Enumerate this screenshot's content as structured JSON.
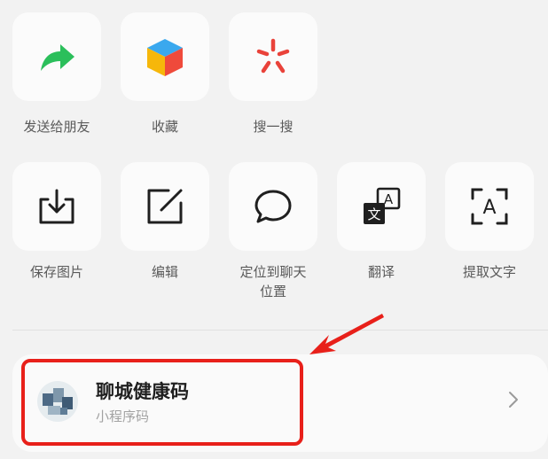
{
  "actions_row1": [
    {
      "label": "发送给朋友",
      "icon": "share-arrow-icon"
    },
    {
      "label": "收藏",
      "icon": "cube-icon"
    },
    {
      "label": "搜一搜",
      "icon": "search-star-icon"
    }
  ],
  "actions_row2": [
    {
      "label": "保存图片",
      "icon": "download-icon"
    },
    {
      "label": "编辑",
      "icon": "edit-icon"
    },
    {
      "label": "定位到聊天位置",
      "label_line1": "定位到聊天",
      "label_line2": "位置",
      "icon": "chat-bubble-icon"
    },
    {
      "label": "翻译",
      "icon": "translate-icon"
    },
    {
      "label": "提取文字",
      "icon": "extract-text-icon"
    }
  ],
  "mini_program": {
    "name": "聊城健康码",
    "type": "小程序码",
    "icon": "mini-program-logo"
  },
  "colors": {
    "highlight": "#e8201a",
    "share_green": "#2bbf5b",
    "accent_red": "#e9423a"
  }
}
